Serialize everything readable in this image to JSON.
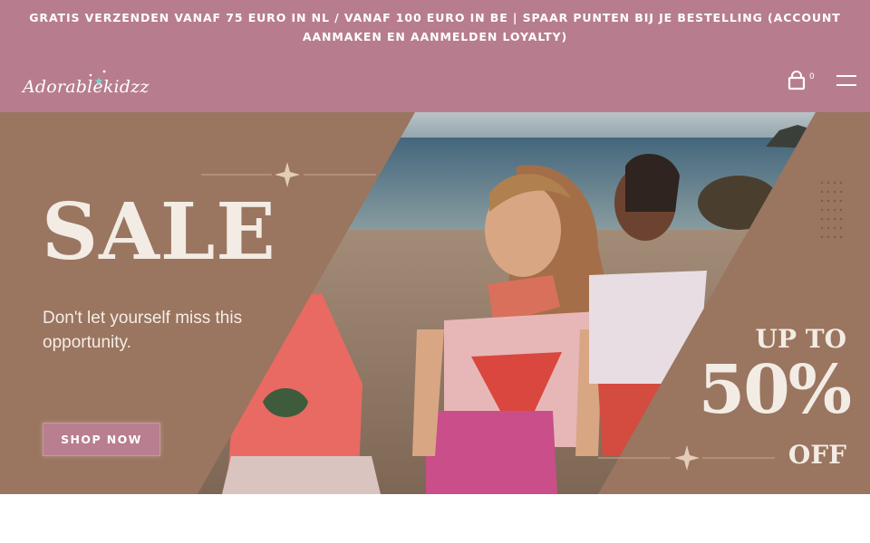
{
  "announcement": {
    "text": "GRATIS VERZENDEN VANAF 75 EURO IN NL / VANAF 100 EURO IN BE | SPAAR PUNTEN BIJ JE BESTELLING (ACCOUNT AANMAKEN EN AANMELDEN LOYALTY)"
  },
  "header": {
    "logo_text": "Adorablekidzz",
    "cart_count": "0",
    "icons": [
      "shopping-bag-icon",
      "hamburger-menu-icon"
    ]
  },
  "hero": {
    "title": "SALE",
    "subtitle": "Don't let yourself miss this opportunity.",
    "button_label": "SHOP NOW",
    "promo_line1": "UP TO",
    "promo_line2": "50%",
    "promo_line3": "OFF"
  },
  "colors": {
    "header_bg": "#b77d8f",
    "hero_brown": "#9a7560",
    "button_bg": "#b97e90",
    "text_light": "#f3ece4"
  }
}
